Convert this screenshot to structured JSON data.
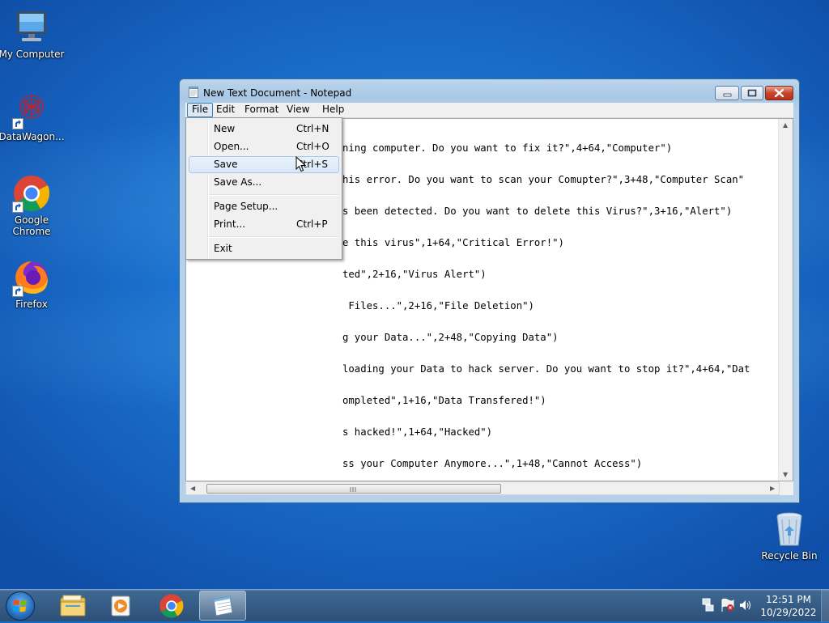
{
  "desktop": {
    "icons": [
      {
        "label": "My Computer",
        "icon": "computer-icon"
      },
      {
        "label": "DataWagon...",
        "icon": "datawagon-icon"
      },
      {
        "label": "Google Chrome",
        "icon": "chrome-icon"
      },
      {
        "label": "Firefox",
        "icon": "firefox-icon"
      },
      {
        "label": "Recycle Bin",
        "icon": "recycle-bin-icon"
      }
    ]
  },
  "notepad": {
    "title": "New Text Document - Notepad",
    "menus": [
      "File",
      "Edit",
      "Format",
      "View",
      "Help"
    ],
    "lines": [
      "ning computer. Do you want to fix it?\",4+64,\"Computer\")",
      "his error. Do you want to scan your Comupter?\",3+48,\"Computer Scan\"",
      "s been detected. Do you want to delete this Virus?\",3+16,\"Alert\")",
      "e this virus\",1+64,\"Critical Error!\")",
      "ted\",2+16,\"Virus Alert\")",
      " Files...\",2+16,\"File Deletion\")",
      "g your Data...\",2+48,\"Copying Data\")",
      "loading your Data to hack server. Do you want to stop it?\",4+64,\"Dat",
      "ompleted\",1+16,\"Data Transfered!\")",
      "s hacked!\",1+64,\"Hacked\")",
      "ss your Computer Anymore...\",1+48,\"Cannot Access\")"
    ]
  },
  "file_menu": {
    "items": [
      {
        "label": "New",
        "shortcut": "Ctrl+N"
      },
      {
        "label": "Open...",
        "shortcut": "Ctrl+O"
      },
      {
        "label": "Save",
        "shortcut": "Ctrl+S"
      },
      {
        "label": "Save As...",
        "shortcut": ""
      },
      {
        "label": "Page Setup...",
        "shortcut": ""
      },
      {
        "label": "Print...",
        "shortcut": "Ctrl+P"
      },
      {
        "label": "Exit",
        "shortcut": ""
      }
    ],
    "highlighted": "Save"
  },
  "taskbar": {
    "pinned": [
      "windows-explorer-icon",
      "media-player-icon",
      "chrome-icon",
      "notepad-icon"
    ],
    "time": "12:51 PM",
    "date": "10/29/2022"
  }
}
